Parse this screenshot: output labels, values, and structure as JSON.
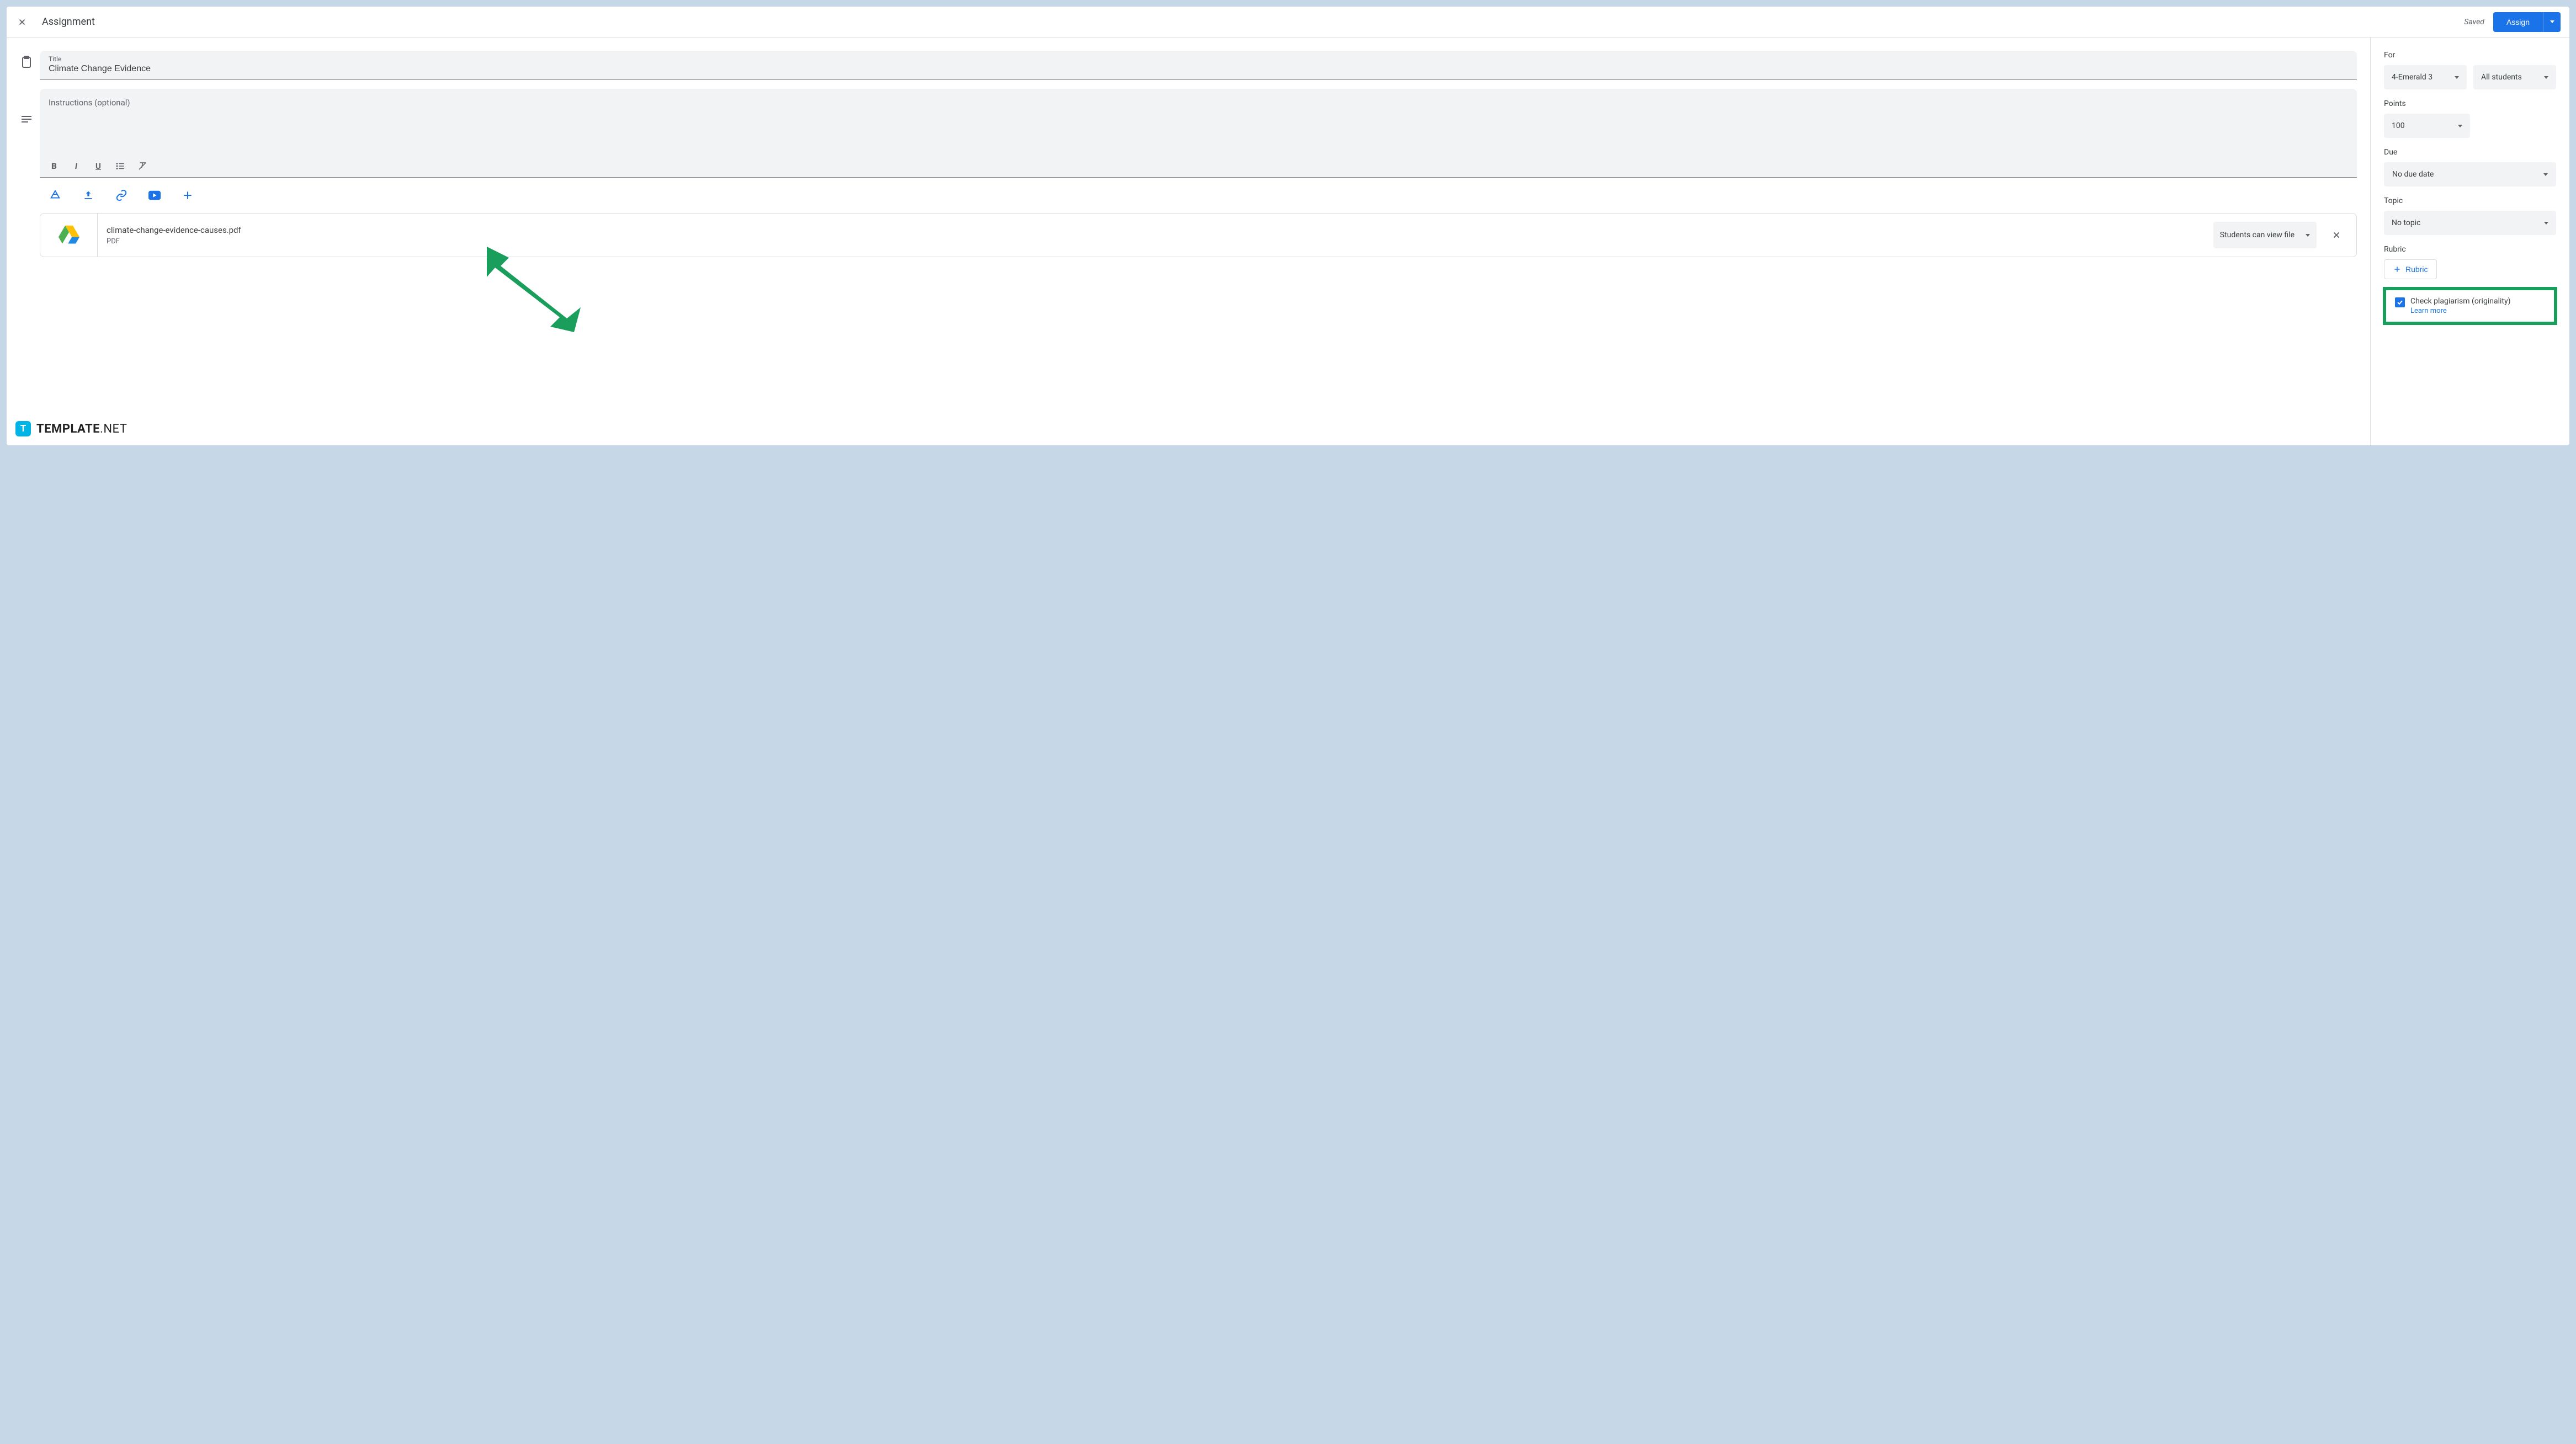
{
  "header": {
    "title": "Assignment",
    "saved": "Saved",
    "assign": "Assign"
  },
  "title_field": {
    "label": "Title",
    "value": "Climate Change Evidence"
  },
  "instructions": {
    "placeholder": "Instructions (optional)"
  },
  "attachment": {
    "name": "climate-change-evidence-causes.pdf",
    "type": "PDF",
    "permission": "Students can view file"
  },
  "sidebar": {
    "for_label": "For",
    "class_value": "4-Emerald 3",
    "students_value": "All students",
    "points_label": "Points",
    "points_value": "100",
    "due_label": "Due",
    "due_value": "No due date",
    "topic_label": "Topic",
    "topic_value": "No topic",
    "rubric_label": "Rubric",
    "rubric_button": "Rubric",
    "plagiarism_label": "Check plagiarism (originality)",
    "learn_more": "Learn more"
  },
  "watermark": {
    "brand": "TEMPLATE",
    "suffix": ".NET"
  }
}
